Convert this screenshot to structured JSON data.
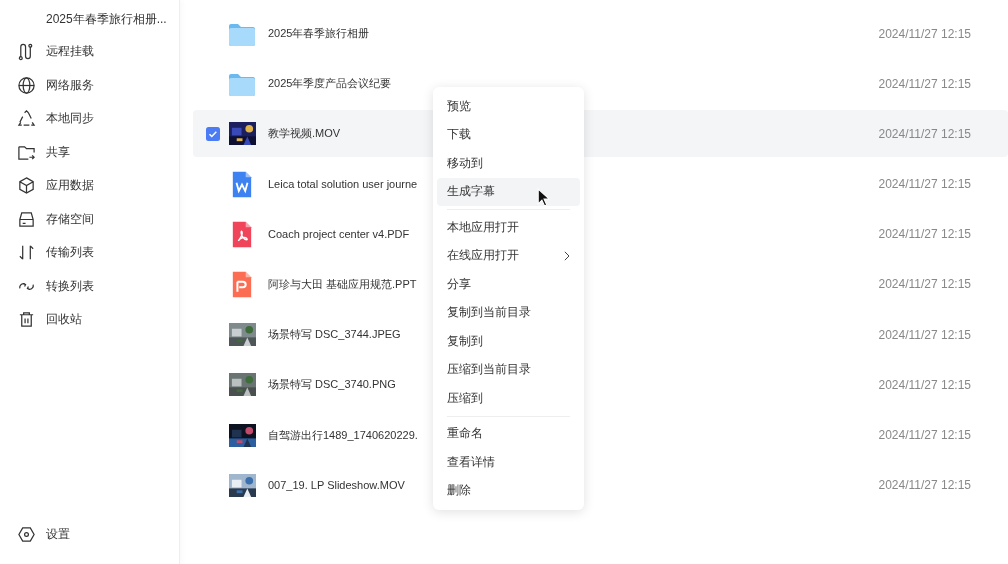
{
  "sidebar": {
    "current_folder": "2025年春季旅行相册...",
    "items": [
      {
        "label": "远程挂载"
      },
      {
        "label": "网络服务"
      },
      {
        "label": "本地同步"
      },
      {
        "label": "共享"
      },
      {
        "label": "应用数据"
      },
      {
        "label": "存储空间"
      },
      {
        "label": "传输列表"
      },
      {
        "label": "转换列表"
      },
      {
        "label": "回收站"
      }
    ],
    "settings": "设置"
  },
  "files": [
    {
      "kind": "folder",
      "name": "2025年春季旅行相册",
      "date": "2024/11/27 12:15",
      "selected": false
    },
    {
      "kind": "folder",
      "name": "2025年季度产品会议纪要",
      "date": "2024/11/27 12:15",
      "selected": false
    },
    {
      "kind": "picture",
      "name": "教学视频.MOV",
      "date": "2024/11/27 12:15",
      "selected": true
    },
    {
      "kind": "word",
      "name": "Leica total solution user journe",
      "date": "2024/11/27 12:15",
      "selected": false
    },
    {
      "kind": "pdf",
      "name": "Coach project center v4.PDF",
      "date": "2024/11/27 12:15",
      "selected": false
    },
    {
      "kind": "ppt",
      "name": "阿珍与大田 基础应用规范.PPT",
      "date": "2024/11/27 12:15",
      "selected": false
    },
    {
      "kind": "picture",
      "name": "场景特写 DSC_3744.JPEG",
      "date": "2024/11/27 12:15",
      "selected": false
    },
    {
      "kind": "picture",
      "name": "场景特写 DSC_3740.PNG",
      "date": "2024/11/27 12:15",
      "selected": false
    },
    {
      "kind": "picture",
      "name": "自驾游出行1489_1740620229.",
      "date": "2024/11/27 12:15",
      "selected": false
    },
    {
      "kind": "picture",
      "name": "007_19. LP Slideshow.MOV",
      "date": "2024/11/27 12:15",
      "selected": false
    }
  ],
  "context_menu": {
    "groups": [
      [
        {
          "label": "预览",
          "selected": false,
          "submenu": false
        },
        {
          "label": "下载",
          "selected": false,
          "submenu": false
        },
        {
          "label": "移动到",
          "selected": false,
          "submenu": false
        },
        {
          "label": "生成字幕",
          "selected": true,
          "submenu": false
        }
      ],
      [
        {
          "label": "本地应用打开",
          "selected": false,
          "submenu": false
        },
        {
          "label": "在线应用打开",
          "selected": false,
          "submenu": true
        },
        {
          "label": "分享",
          "selected": false,
          "submenu": false
        },
        {
          "label": "复制到当前目录",
          "selected": false,
          "submenu": false
        },
        {
          "label": "复制到",
          "selected": false,
          "submenu": false
        },
        {
          "label": "压缩到当前目录",
          "selected": false,
          "submenu": false
        },
        {
          "label": "压缩到",
          "selected": false,
          "submenu": false
        }
      ],
      [
        {
          "label": "重命名",
          "selected": false,
          "submenu": false
        },
        {
          "label": "查看详情",
          "selected": false,
          "submenu": false
        },
        {
          "label": "删除",
          "selected": false,
          "submenu": false
        }
      ]
    ]
  }
}
